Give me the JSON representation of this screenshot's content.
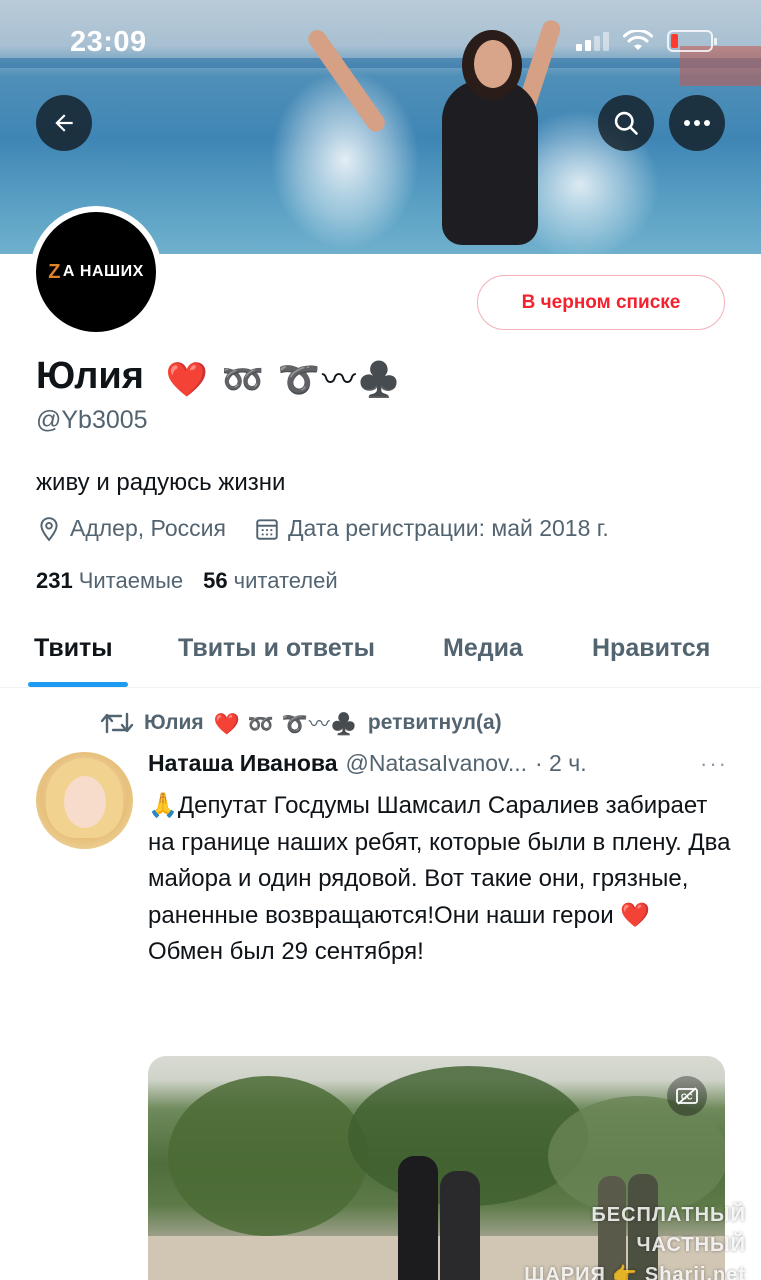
{
  "status_bar": {
    "time": "23:09"
  },
  "profile": {
    "avatar_text": "ZA НАШИХ",
    "avatar_z": "Z",
    "avatar_rest": "А НАШИХ",
    "blocked_label": "В черном списке",
    "name": "Юлия",
    "name_emoji": "❤️ ➿ ➰〰♣️",
    "handle": "@Yb3005",
    "bio": "живу и радуюсь жизни",
    "location": "Адлер, Россия",
    "joined": "Дата регистрации: май 2018 г.",
    "following_count": "231",
    "following_label": "Читаемые",
    "followers_count": "56",
    "followers_label": "читателей"
  },
  "tabs": [
    {
      "label": "Твиты",
      "active": true
    },
    {
      "label": "Твиты и ответы",
      "active": false
    },
    {
      "label": "Медиа",
      "active": false
    },
    {
      "label": "Нравится",
      "active": false
    }
  ],
  "tweet": {
    "retweeter": "Юлия",
    "retweeter_emoji": "❤️ ➿ ➰〰♣️",
    "retweet_label": "ретвитнул(а)",
    "author": "Наташа Иванова",
    "username": "@NatasaIvanov...",
    "time": "· 2 ч.",
    "more": "···",
    "text": "🙏Депутат Госдумы Шамсаил Саралиев забирает на границе наших ребят, которые были в плену. Два майора и один рядовой. Вот такие они, грязные, раненные возвращаются!Они наши герои ❤️",
    "text2": "Обмен был 29 сентября!"
  },
  "watermark": {
    "line1": "БЕСПЛАТНЫЙ ЧАСТНЫЙ",
    "line2": "ШАРИЯ 👉 Sharij.net"
  },
  "colors": {
    "accent": "#1d9bf0",
    "blocked": "#f4212e",
    "secondary_text": "#536471"
  }
}
